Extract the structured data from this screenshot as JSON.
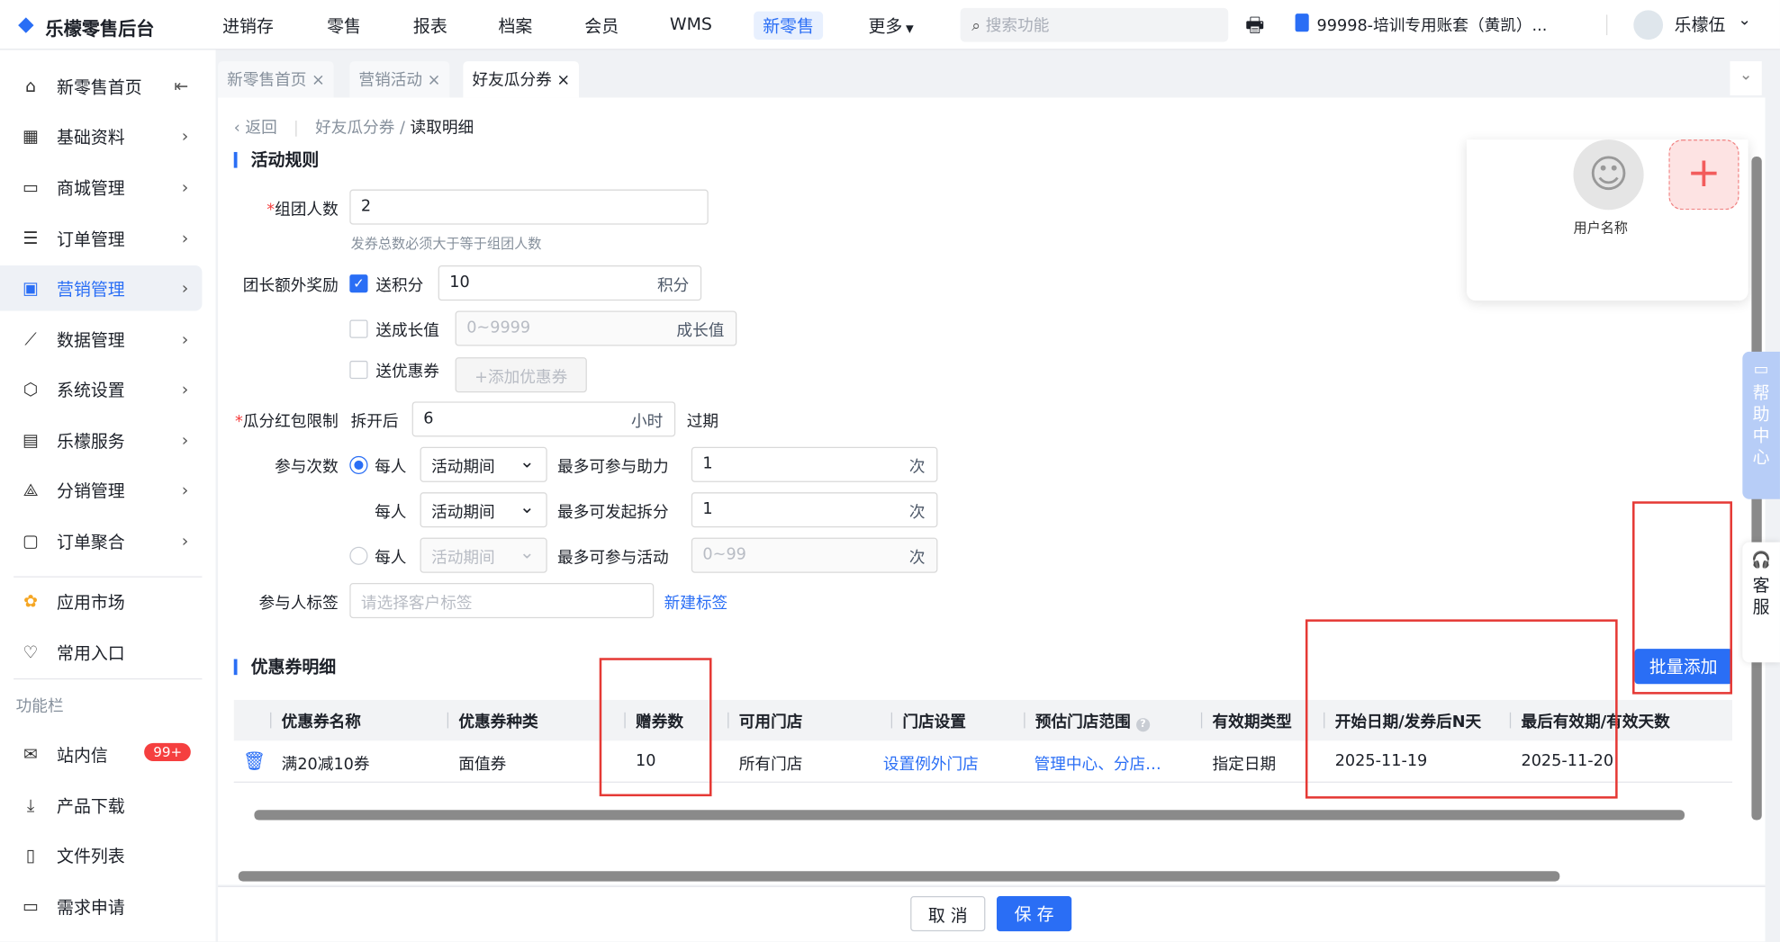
{
  "header": {
    "logo": "乐檬零售后台",
    "nav": [
      "进销存",
      "零售",
      "报表",
      "档案",
      "会员",
      "WMS",
      "新零售",
      "更多"
    ],
    "active_nav": "新零售",
    "search_placeholder": "搜索功能",
    "account": "99998-培训专用账套（黄凯）...",
    "user": "乐檬伍"
  },
  "sidebar": {
    "items": [
      {
        "label": "新零售首页",
        "icon": "home-icon"
      },
      {
        "label": "基础资料",
        "icon": "grid-icon"
      },
      {
        "label": "商城管理",
        "icon": "shop-icon"
      },
      {
        "label": "订单管理",
        "icon": "order-icon"
      },
      {
        "label": "营销管理",
        "icon": "marketing-icon"
      },
      {
        "label": "数据管理",
        "icon": "chart-icon"
      },
      {
        "label": "系统设置",
        "icon": "settings-icon"
      },
      {
        "label": "乐檬服务",
        "icon": "service-icon"
      },
      {
        "label": "分销管理",
        "icon": "distribution-icon"
      },
      {
        "label": "订单聚合",
        "icon": "aggregate-icon"
      }
    ],
    "app_market": "应用市场",
    "favorites": "常用入口",
    "section_label": "功能栏",
    "tools": [
      {
        "label": "站内信",
        "badge": "99+"
      },
      {
        "label": "产品下载"
      },
      {
        "label": "文件列表"
      },
      {
        "label": "需求申请"
      }
    ]
  },
  "tabs": [
    "新零售首页",
    "营销活动",
    "好友瓜分券"
  ],
  "breadcrumb": {
    "back": "返回",
    "parent": "好友瓜分券",
    "current": "读取明细"
  },
  "rules": {
    "title": "活动规则",
    "group_size_label": "组团人数",
    "group_size": "2",
    "group_hint": "发券总数必须大于等于组团人数",
    "leader_reward_label": "团长额外奖励",
    "points_label": "送积分",
    "points": "10",
    "points_unit": "积分",
    "growth_label": "送成长值",
    "growth_placeholder": "0~9999",
    "growth_unit": "成长值",
    "coupon_label": "送优惠券",
    "add_coupon": "+添加优惠券",
    "limit_label": "瓜分红包限制",
    "limit_prefix": "拆开后",
    "limit_hours": "6",
    "limit_unit": "小时",
    "limit_suffix": "过期",
    "times_label": "参与次数",
    "per_person": "每人",
    "period": "活动期间",
    "times": [
      {
        "label": "最多可参与助力",
        "value": "1",
        "unit": "次"
      },
      {
        "label": "最多可发起拆分",
        "value": "1",
        "unit": "次"
      },
      {
        "label": "最多可参与活动",
        "placeholder": "0~99",
        "unit": "次"
      }
    ],
    "tag_label": "参与人标签",
    "tag_placeholder": "请选择客户标签",
    "new_tag": "新建标签"
  },
  "preview": {
    "user_name": "用户名称"
  },
  "coupons": {
    "title": "优惠券明细",
    "batch_add": "批量添加",
    "columns": [
      "优惠券名称",
      "优惠券种类",
      "赠券数",
      "可用门店",
      "门店设置",
      "预估门店范围",
      "有效期类型",
      "开始日期/发券后N天",
      "最后有效期/有效天数"
    ],
    "rows": [
      [
        "满20减10券",
        "面值券",
        "10",
        "所有门店",
        "设置例外门店",
        "管理中心、分店…",
        "指定日期",
        "2025-11-19",
        "2025-11-20"
      ]
    ]
  },
  "footer": {
    "cancel": "取 消",
    "save": "保 存"
  },
  "float": {
    "help": "帮助中心",
    "service": "客服"
  },
  "colors": {
    "accent": "#2a6ef5",
    "annotation": "#e53935"
  }
}
